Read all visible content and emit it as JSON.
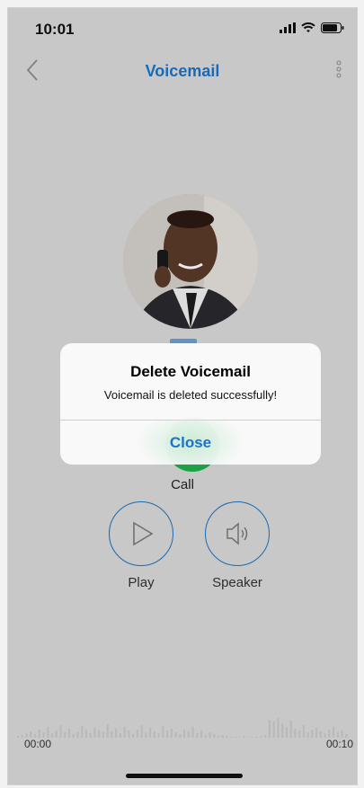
{
  "status_bar": {
    "time": "10:01"
  },
  "nav": {
    "title": "Voicemail"
  },
  "actions": {
    "call_label": "Call",
    "play_label": "Play",
    "speaker_label": "Speaker"
  },
  "player": {
    "time_start": "00:00",
    "time_end": "00:10"
  },
  "alert": {
    "title": "Delete Voicemail",
    "message": "Voicemail is deleted successfully!",
    "close_label": "Close"
  },
  "colors": {
    "accent": "#1a73c9",
    "call_green": "#1fb04a"
  }
}
